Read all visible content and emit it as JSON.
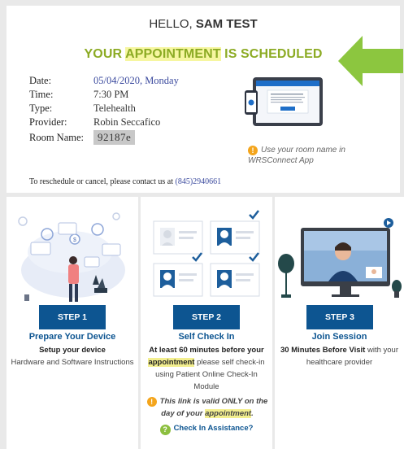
{
  "header": {
    "greeting": "HELLO,",
    "name": "SAM TEST",
    "headline_part1": "YOUR ",
    "headline_highlight": "APPOINTMENT",
    "headline_part2": " IS SCHEDULED"
  },
  "details": [
    {
      "label": "Date:",
      "value": "05/04/2020, Monday",
      "style": "blue"
    },
    {
      "label": "Time:",
      "value": "7:30 PM",
      "style": "plain"
    },
    {
      "label": "Type:",
      "value": "Telehealth",
      "style": "plain"
    },
    {
      "label": "Provider:",
      "value": "Robin Seccafico",
      "style": "plain"
    },
    {
      "label": "Room Name:",
      "value": "92187e",
      "style": "room"
    }
  ],
  "contact": {
    "text": "To reschedule or cancel, please contact us at ",
    "phone": "(845)2940661"
  },
  "app_note": {
    "icon": "!",
    "text": "Use your room name in WRSConnect App"
  },
  "steps": [
    {
      "button": "STEP 1",
      "title": "Prepare Your Device",
      "line1": "Setup your device",
      "line2": "Hardware and Software Instructions"
    },
    {
      "button": "STEP 2",
      "title": "Self Check In",
      "line1a": "At least 60 minutes before your ",
      "line1b": "appointment",
      "line1c": " please self check-in using Patient Online Check-In Module",
      "note_a": "This link is valid ONLY on the day of your ",
      "note_b": "appointment",
      "note_c": ".",
      "assist": "Check In Assistance?"
    },
    {
      "button": "STEP 3",
      "title": "Join Session",
      "line1a": "30 Minutes Before Visit",
      "line1b": " with your healthcare provider"
    }
  ],
  "colors": {
    "headline": "#8cab24",
    "step_button": "#0d5591",
    "arrow": "#8cc63f",
    "warning": "#f4a51c"
  }
}
